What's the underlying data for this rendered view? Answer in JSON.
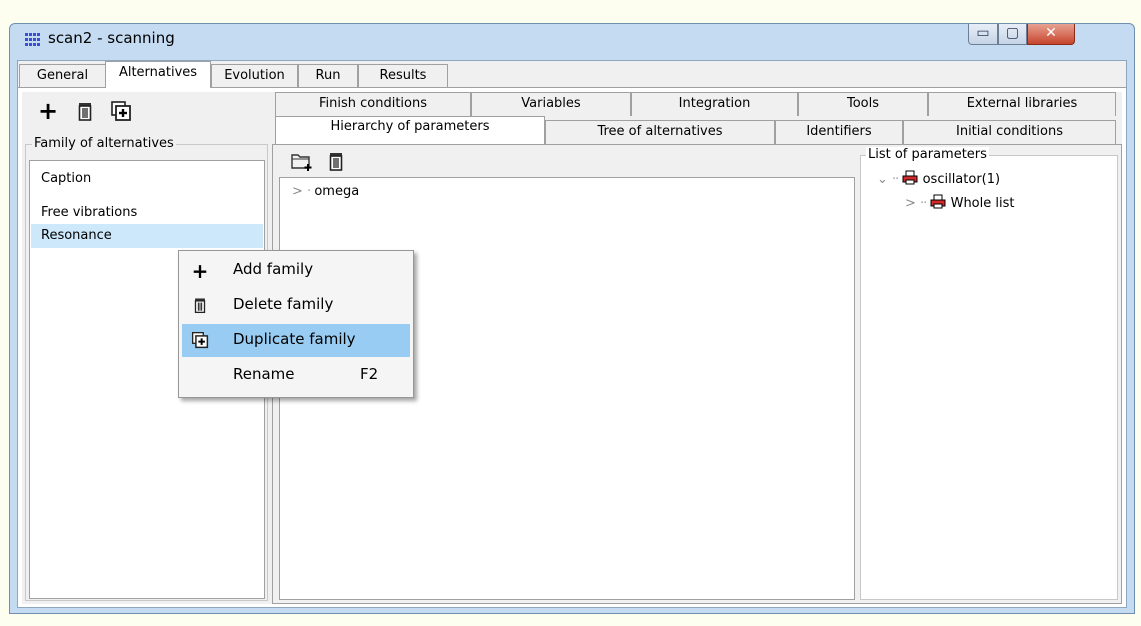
{
  "window": {
    "title": "scan2 - scanning",
    "controls": {
      "minimize": "▭",
      "maximize": "▢",
      "close": "✕"
    }
  },
  "main_tabs": [
    {
      "label": "General",
      "active": false
    },
    {
      "label": "Alternatives",
      "active": true
    },
    {
      "label": "Evolution",
      "active": false
    },
    {
      "label": "Run",
      "active": false
    },
    {
      "label": "Results",
      "active": false
    }
  ],
  "left_pane": {
    "toolbar": {
      "add_icon": "plus-icon",
      "delete_icon": "trash-icon",
      "duplicate_icon": "duplicate-icon"
    },
    "group_label": "Family of alternatives",
    "items": [
      {
        "label": "Caption",
        "selected": false
      },
      {
        "label": "Free vibrations",
        "selected": false
      },
      {
        "label": "Resonance",
        "selected": true
      }
    ]
  },
  "sub_tabs": {
    "row1": [
      "Finish conditions",
      "Variables",
      "Integration",
      "Tools",
      "External libraries"
    ],
    "row2": [
      "Hierarchy of parameters",
      "Tree of alternatives",
      "Identifiers",
      "Initial conditions"
    ],
    "active": "Hierarchy of parameters"
  },
  "hierarchy": {
    "toolbar": {
      "new_folder_icon": "new-folder-icon",
      "delete_icon": "trash-icon"
    },
    "rows": [
      {
        "label": "omega"
      }
    ]
  },
  "parameters": {
    "group_label": "List of parameters",
    "tree": [
      {
        "label": "oscillator(1)",
        "expanded": true
      },
      {
        "label": "Whole list",
        "expanded": false
      }
    ]
  },
  "context_menu": {
    "items": [
      {
        "icon": "plus-icon",
        "label": "Add family",
        "shortcut": ""
      },
      {
        "icon": "trash-icon",
        "label": "Delete family",
        "shortcut": ""
      },
      {
        "icon": "duplicate-icon",
        "label": "Duplicate family",
        "shortcut": "",
        "highlighted": true
      },
      {
        "icon": "",
        "label": "Rename",
        "shortcut": "F2"
      }
    ]
  },
  "colors": {
    "selection": "#cde8fb",
    "menu_highlight": "#99ccf2",
    "window_frame": "#c4dbf2",
    "close_button": "#c6452d"
  }
}
